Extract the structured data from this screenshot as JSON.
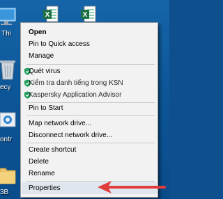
{
  "desktop": {
    "icons": [
      {
        "label": "Thi",
        "kind": "this-pc"
      },
      {
        "label": "ecy",
        "kind": "recycle-bin"
      },
      {
        "label": "ontr",
        "kind": "control-panel"
      },
      {
        "label": "3B",
        "kind": "folder"
      }
    ],
    "excel_files": [
      {
        "kind": "excel-file"
      },
      {
        "kind": "excel-file"
      }
    ]
  },
  "context_menu": {
    "items": [
      {
        "label": "Open",
        "bold": true
      },
      {
        "label": "Pin to Quick access"
      },
      {
        "label": "Manage"
      },
      {
        "label": "Quét virus",
        "icon": "kaspersky-shield-icon"
      },
      {
        "label": "Kiểm tra danh tiếng trong KSN",
        "icon": "kaspersky-shield-icon"
      },
      {
        "label": "Kaspersky Application Advisor",
        "icon": "kaspersky-shield-icon"
      },
      {
        "label": "Pin to Start"
      },
      {
        "label": "Map network drive..."
      },
      {
        "label": "Disconnect network drive..."
      },
      {
        "label": "Create shortcut"
      },
      {
        "label": "Delete"
      },
      {
        "label": "Rename"
      },
      {
        "label": "Properties",
        "highlighted": true
      }
    ]
  },
  "colors": {
    "desktop_bg": "#0c5597",
    "menu_bg": "#f2f2f2",
    "highlight": "#dfe6ee",
    "kaspersky_green": "#1e9e5c",
    "arrow_red": "#e03c3c",
    "excel_green": "#1d7044"
  }
}
